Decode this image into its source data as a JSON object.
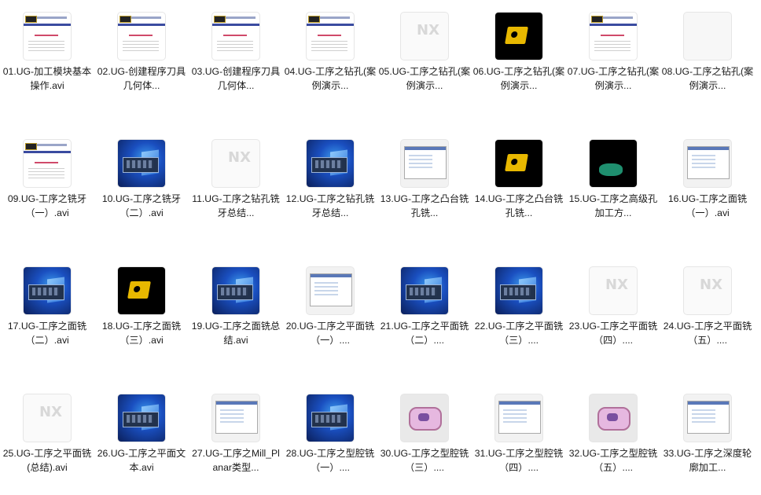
{
  "files": [
    {
      "name": "01.UG-加工模块基本操作.avi",
      "thumb": "doc"
    },
    {
      "name": "02.UG-创建程序刀具几何体...",
      "thumb": "doc"
    },
    {
      "name": "03.UG-创建程序刀具几何体...",
      "thumb": "doc"
    },
    {
      "name": "04.UG-工序之钻孔(案例演示...",
      "thumb": "doc"
    },
    {
      "name": "05.UG-工序之钻孔(案例演示...",
      "thumb": "nx"
    },
    {
      "name": "06.UG-工序之钻孔(案例演示...",
      "thumb": "black"
    },
    {
      "name": "07.UG-工序之钻孔(案例演示...",
      "thumb": "doc"
    },
    {
      "name": "08.UG-工序之钻孔(案例演示...",
      "thumb": "white"
    },
    {
      "name": "09.UG-工序之铣牙（一）.avi",
      "thumb": "doc"
    },
    {
      "name": "10.UG-工序之铣牙（二）.avi",
      "thumb": "win"
    },
    {
      "name": "11.UG-工序之钻孔铣牙总结...",
      "thumb": "nx"
    },
    {
      "name": "12.UG-工序之钻孔铣牙总结...",
      "thumb": "win"
    },
    {
      "name": "13.UG-工序之凸台铣孔铣...",
      "thumb": "screen"
    },
    {
      "name": "14.UG-工序之凸台铣孔铣...",
      "thumb": "black"
    },
    {
      "name": "15.UG-工序之高级孔加工方...",
      "thumb": "black"
    },
    {
      "name": "16.UG-工序之面铣（一）.avi",
      "thumb": "screen"
    },
    {
      "name": "17.UG-工序之面铣（二）.avi",
      "thumb": "win"
    },
    {
      "name": "18.UG-工序之面铣（三）.avi",
      "thumb": "black"
    },
    {
      "name": "19.UG-工序之面铣总结.avi",
      "thumb": "win"
    },
    {
      "name": "20.UG-工序之平面铣（一）....",
      "thumb": "screen"
    },
    {
      "name": "21.UG-工序之平面铣（二）....",
      "thumb": "win"
    },
    {
      "name": "22.UG-工序之平面铣（三）....",
      "thumb": "win"
    },
    {
      "name": "23.UG-工序之平面铣（四）....",
      "thumb": "nx"
    },
    {
      "name": "24.UG-工序之平面铣（五）....",
      "thumb": "nx"
    },
    {
      "name": "25.UG-工序之平面铣(总结).avi",
      "thumb": "nx"
    },
    {
      "name": "26.UG-工序之平面文本.avi",
      "thumb": "win"
    },
    {
      "name": "27.UG-工序之Mill_Planar类型...",
      "thumb": "screen"
    },
    {
      "name": "28.UG-工序之型腔铣（一）....",
      "thumb": "win"
    },
    {
      "name": "30.UG-工序之型腔铣（三）....",
      "thumb": "pink"
    },
    {
      "name": "31.UG-工序之型腔铣（四）....",
      "thumb": "screen"
    },
    {
      "name": "32.UG-工序之型腔铣（五）....",
      "thumb": "pink"
    },
    {
      "name": "33.UG-工序之深度轮廓加工...",
      "thumb": "screen"
    }
  ]
}
